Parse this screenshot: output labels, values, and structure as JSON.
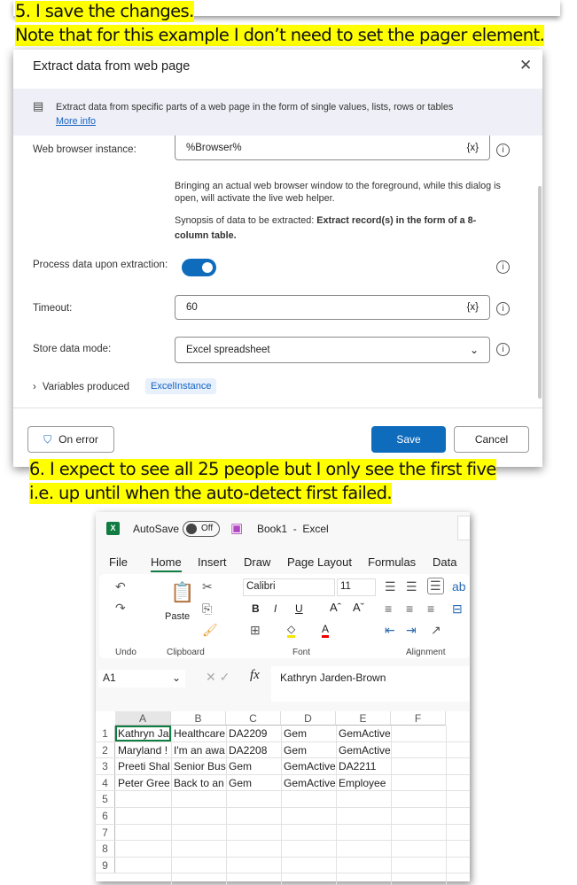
{
  "captions": {
    "step5": "5. I save the changes.",
    "note": "Note that for this example I don’t need to set the pager element.",
    "step6_line1": "6. I expect to see all 25 people but I only see the first five",
    "step6_line2": "i.e. up until  when the auto-detect first failed."
  },
  "dialog": {
    "title": "Extract data from web page",
    "banner_text": "Extract data from specific parts of a web page in the form of single values, lists, rows or tables",
    "more_info": "More info",
    "browser_label": "Web browser instance:",
    "browser_value": "%Browser%",
    "var_icon": "{x}",
    "helper_text": "Bringing an actual web browser window to the foreground, while this dialog is open, will activate the live web helper.",
    "synopsis_prefix": "Synopsis of data to be extracted: ",
    "synopsis_bold": "Extract record(s) in the form of a 8-column table.",
    "process_label": "Process data upon extraction:",
    "process_on": true,
    "timeout_label": "Timeout:",
    "timeout_value": "60",
    "store_label": "Store data mode:",
    "store_value": "Excel spreadsheet",
    "variables_label": "Variables produced",
    "variable_badge": "ExcelInstance",
    "on_error": "On error",
    "save": "Save",
    "cancel": "Cancel",
    "accent": "#0f6cbd"
  },
  "excel": {
    "autosave": "AutoSave",
    "autosave_state": "Off",
    "title": "Book1  -  Excel",
    "tabs": [
      "File",
      "Home",
      "Insert",
      "Draw",
      "Page Layout",
      "Formulas",
      "Data"
    ],
    "active_tab": "Home",
    "font_name": "Calibri",
    "font_size": "11",
    "paste": "Paste",
    "groups": [
      "Undo",
      "Clipboard",
      "Font",
      "Alignment"
    ],
    "name_box": "A1",
    "fx": "fx",
    "formula": "Kathryn Jarden-Brown",
    "columns": [
      "A",
      "B",
      "C",
      "D",
      "E",
      "F"
    ],
    "row_numbers": [
      "1",
      "2",
      "3",
      "4",
      "5",
      "6",
      "7",
      "8",
      "9"
    ],
    "rows": [
      [
        "Kathryn Ja",
        "Healthcare",
        "DA2209",
        "Gem",
        "GemActive",
        ""
      ],
      [
        "Maryland !",
        "I'm an awa",
        "DA2208",
        "Gem",
        "GemActive",
        ""
      ],
      [
        "Preeti Shal",
        "Senior Bus",
        "Gem",
        "GemActive",
        "DA2211",
        ""
      ],
      [
        "Peter Gree",
        "Back to an",
        "Gem",
        "GemActive",
        "Employee",
        ""
      ]
    ]
  }
}
